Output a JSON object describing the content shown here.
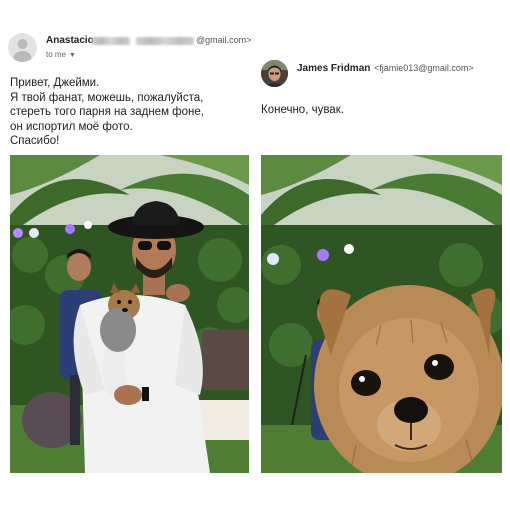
{
  "email_left": {
    "sender_name": "Anastacio",
    "sender_email_suffix": "@gmail.com>",
    "recipient": "to me",
    "message_lines": [
      "Привет, Джейми.",
      "Я твой фанат, можешь, пожалуйста,",
      "стереть того парня на заднем фоне,",
      "он испортил моё фото.",
      "Спасибо!"
    ],
    "avatar_icon": "person-silhouette-icon"
  },
  "email_right": {
    "sender_name": "James Fridman",
    "sender_email": "<fjamie013@gmail.com>",
    "message": "Конечно, чувак."
  },
  "photos": {
    "left": "man-in-black-hat-holding-yorkshire-terrier-in-garden",
    "right": "yorkshire-terrier-face-close-up-in-garden"
  },
  "colors": {
    "text": "#222222",
    "muted": "#666666",
    "foliage": "#3c6a2c",
    "dog": "#b88a55"
  }
}
